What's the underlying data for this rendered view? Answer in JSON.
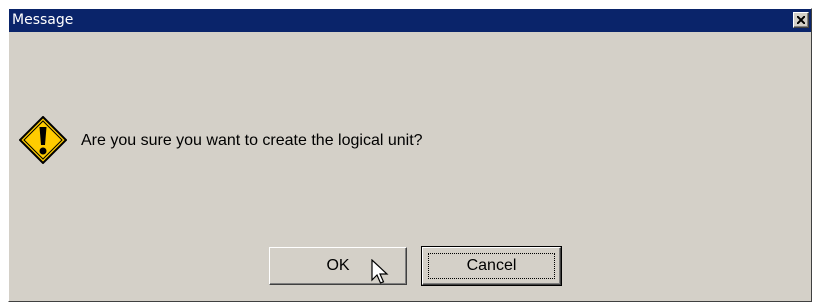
{
  "window": {
    "title": "Message",
    "close_icon": "close-icon"
  },
  "dialog": {
    "icon": "warning-icon",
    "message": "Are you sure you want to create the logical unit?"
  },
  "buttons": {
    "ok_label": "OK",
    "cancel_label": "Cancel"
  },
  "colors": {
    "titlebar": "#0a246a",
    "dialog_bg": "#d4d0c8",
    "icon_fill": "#ffcc00"
  }
}
